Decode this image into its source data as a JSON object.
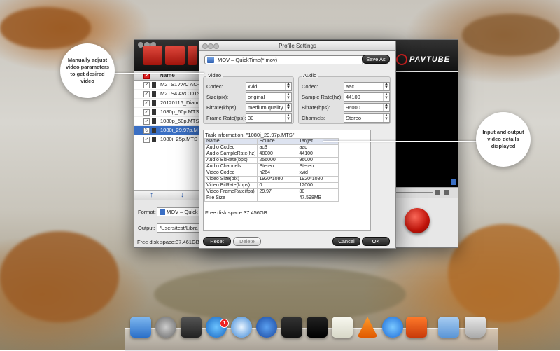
{
  "window": {
    "title": "Profile Settings"
  },
  "app": {
    "brand": "PAVTUBE",
    "file_list_header": "Name",
    "files": [
      {
        "name": "M2TS1 AVC AC-",
        "selected": false
      },
      {
        "name": "M2TS4 AVC DTS",
        "selected": false
      },
      {
        "name": "20120116_Diam",
        "selected": false
      },
      {
        "name": "1080p_60p.MTS",
        "selected": false
      },
      {
        "name": "1080p_50p.MTS",
        "selected": false
      },
      {
        "name": "1080i_29.97p.M",
        "selected": true
      },
      {
        "name": "1080i_25p.MTS",
        "selected": false
      }
    ],
    "format_label": "Format:",
    "format_value": "MOV – Quick",
    "output_label": "Output:",
    "output_value": "/Users/test/Libra",
    "free_disk": "Free disk space:37.461GB"
  },
  "dialog": {
    "profile_value": "MOV – QuickTime(*.mov)",
    "save_as": "Save As",
    "video": {
      "title": "Video",
      "codec_label": "Codec:",
      "codec_value": "xvid",
      "size_label": "Size(pix):",
      "size_value": "original",
      "bitrate_label": "Bitrate(kbps):",
      "bitrate_value": "medium quality",
      "framerate_label": "Frame Rate(fps):",
      "framerate_value": "30"
    },
    "audio": {
      "title": "Audio",
      "codec_label": "Codec:",
      "codec_value": "aac",
      "samplerate_label": "Sample Rate(hz):",
      "samplerate_value": "44100",
      "bitrate_label": "Bitrate(bps):",
      "bitrate_value": "96000",
      "channels_label": "Channels:",
      "channels_value": "Stereo"
    },
    "task_info": "Task information: \"1080i_29.97p.MTS\"",
    "table": {
      "headers": [
        "Name",
        "Source",
        "Target"
      ],
      "rows": [
        [
          "Audio Codec",
          "ac3",
          "aac"
        ],
        [
          "Audio SampleRate(hz)",
          "48000",
          "44100"
        ],
        [
          "Audio BitRate(bps)",
          "256000",
          "96000"
        ],
        [
          "Audio Channels",
          "Stereo",
          "Stereo"
        ],
        [
          "Video Codec",
          "h264",
          "xvid"
        ],
        [
          "Video Size(pix)",
          "1920*1080",
          "1920*1080"
        ],
        [
          "Video BitRate(kbps)",
          "0",
          "12000"
        ],
        [
          "Video FrameRate(fps)",
          "29.97",
          "30"
        ],
        [
          "File Size",
          "",
          "47.598MB"
        ]
      ]
    },
    "free_disk": "Free disk space:37.456GB",
    "reset": "Reset",
    "delete": "Delete",
    "cancel": "Cancel",
    "ok": "OK"
  },
  "callouts": {
    "left": "Manually adjust video parameters to get desired video",
    "right": "Input and output video details displayed"
  },
  "dock": {
    "badge": "1"
  }
}
